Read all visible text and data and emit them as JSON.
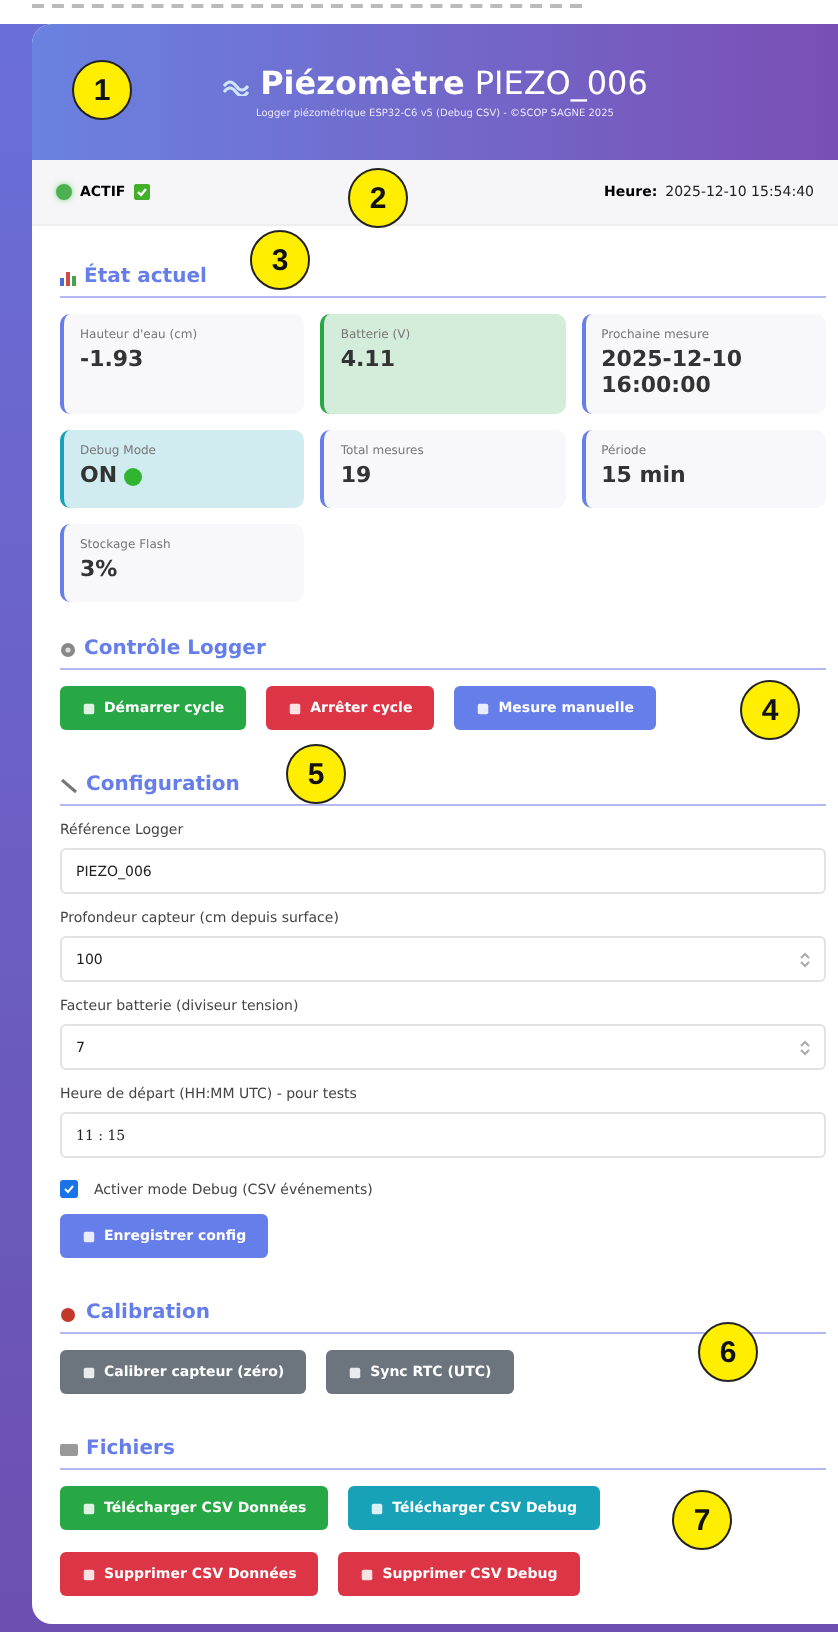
{
  "header": {
    "title": "Piézomètre",
    "device": "PIEZO_006",
    "subtitle": "Logger piézométrique ESP32-C6 v5 (Debug CSV) - ©SCOP SAGNE 2025"
  },
  "status": {
    "label": "ACTIF",
    "active": true,
    "time_label": "Heure:",
    "time": "2025-12-10 15:54:40"
  },
  "state_section": {
    "title": "État actuel",
    "stats": [
      {
        "label": "Hauteur d'eau (cm)",
        "value": "-1.93",
        "kind": "plain"
      },
      {
        "label": "Batterie (V)",
        "value": "4.11",
        "kind": "success"
      },
      {
        "label": "Prochaine mesure",
        "value": "2025-12-10 16:00:00",
        "kind": "plain"
      },
      {
        "label": "Debug Mode",
        "value": "ON",
        "kind": "info"
      },
      {
        "label": "Total mesures",
        "value": "19",
        "kind": "plain"
      },
      {
        "label": "Période",
        "value": "15 min",
        "kind": "plain"
      },
      {
        "label": "Stockage Flash",
        "value": "3%",
        "kind": "plain"
      }
    ]
  },
  "control_section": {
    "title": "Contrôle Logger",
    "buttons": [
      {
        "label": "Démarrer cycle",
        "color": "#28a745"
      },
      {
        "label": "Arrêter cycle",
        "color": "#dc3545"
      },
      {
        "label": "Mesure manuelle",
        "color": "#667eea"
      }
    ]
  },
  "config_section": {
    "title": "Configuration",
    "fields": [
      {
        "label": "Référence Logger",
        "value": "PIEZO_006",
        "kind": "text"
      },
      {
        "label": "Profondeur capteur (cm depuis surface)",
        "value": "100",
        "kind": "number"
      },
      {
        "label": "Facteur batterie (diviseur tension)",
        "value": "7",
        "kind": "number"
      },
      {
        "label": "Heure de départ (HH:MM UTC) - pour tests",
        "value": "11 : 15",
        "kind": "time"
      }
    ],
    "debug_checkbox": {
      "label": "Activer mode Debug (CSV événements)",
      "checked": true
    },
    "save_button": "Enregistrer config"
  },
  "calibration_section": {
    "title": "Calibration",
    "buttons": [
      {
        "label": "Calibrer capteur (zéro)",
        "color": "#6c757d"
      },
      {
        "label": "Sync RTC (UTC)",
        "color": "#6c757d"
      }
    ]
  },
  "files_section": {
    "title": "Fichiers",
    "buttons": [
      {
        "label": "Télécharger CSV Données",
        "color": "#28a745"
      },
      {
        "label": "Télécharger CSV Debug",
        "color": "#17a2b8"
      },
      {
        "label": "Supprimer CSV Données",
        "color": "#dc3545"
      },
      {
        "label": "Supprimer CSV Debug",
        "color": "#dc3545"
      }
    ]
  },
  "callouts": [
    {
      "label": "1"
    },
    {
      "label": "2"
    },
    {
      "label": "3"
    },
    {
      "label": "4"
    },
    {
      "label": "5"
    },
    {
      "label": "6"
    },
    {
      "label": "7"
    }
  ]
}
